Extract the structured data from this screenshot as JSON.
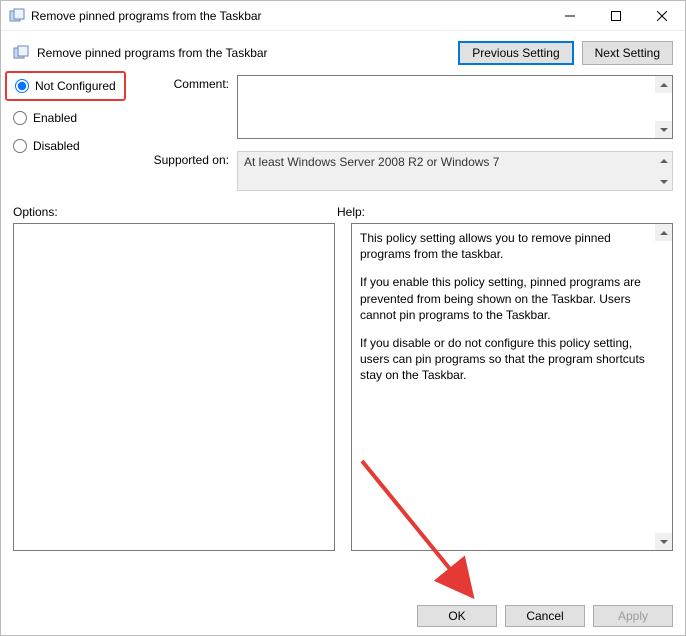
{
  "titlebar": {
    "title": "Remove pinned programs from the Taskbar"
  },
  "secondbar": {
    "subtitle": "Remove pinned programs from the Taskbar",
    "prev_btn": "Previous Setting",
    "next_btn": "Next Setting"
  },
  "radios": {
    "not_configured": "Not Configured",
    "enabled": "Enabled",
    "disabled": "Disabled"
  },
  "fields": {
    "comment_label": "Comment:",
    "comment_value": "",
    "supported_label": "Supported on:",
    "supported_value": "At least Windows Server 2008 R2 or Windows 7"
  },
  "panes": {
    "options_label": "Options:",
    "help_label": "Help:",
    "help_body": {
      "p1": "This policy setting allows you to remove pinned programs from the taskbar.",
      "p2": "If you enable this policy setting, pinned programs are prevented from being shown on the Taskbar. Users cannot pin programs to the Taskbar.",
      "p3": "If you disable or do not configure this policy setting, users can pin programs so that the program shortcuts stay on the Taskbar."
    }
  },
  "footer": {
    "ok": "OK",
    "cancel": "Cancel",
    "apply": "Apply"
  }
}
